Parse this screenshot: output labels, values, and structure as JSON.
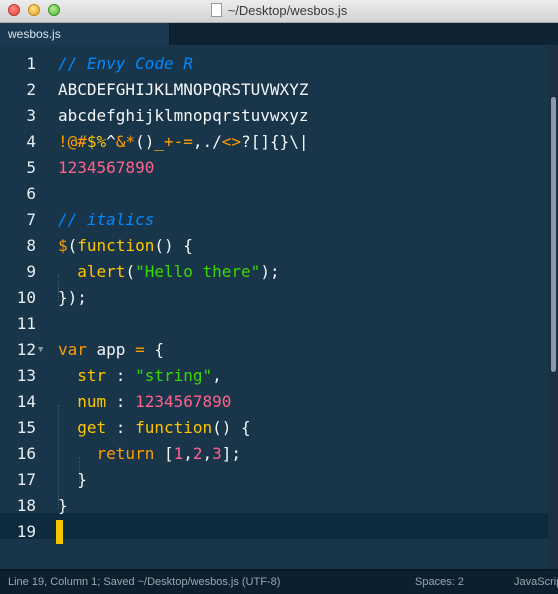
{
  "window": {
    "title": "~/Desktop/wesbos.js"
  },
  "tabs": [
    {
      "label": "wesbos.js"
    }
  ],
  "editor": {
    "line_numbers": [
      "1",
      "2",
      "3",
      "4",
      "5",
      "6",
      "7",
      "8",
      "9",
      "10",
      "11",
      "12",
      "13",
      "14",
      "15",
      "16",
      "17",
      "18",
      "19"
    ],
    "lines": {
      "l1": "// Envy Code R",
      "l2": "ABCDEFGHIJKLMNOPQRSTUVWXYZ",
      "l3": "abcdefghijklmnopqrstuvwxyz",
      "l4": {
        "a": "!@#",
        "b": "$%",
        "c": "^",
        "d": "&*",
        "e": "()",
        "f": "_",
        "g": "+-=",
        "h": ",./",
        "i": "<>",
        "j": "?[]{}\\|"
      },
      "l5": "1234567890",
      "l7": "// italics",
      "l8": {
        "a": "$",
        "b": "(",
        "c": "function",
        "d": "() {"
      },
      "l9": {
        "a": "alert",
        "b": "(",
        "c": "\"Hello there\"",
        "d": ");"
      },
      "l10": "});",
      "l12": {
        "a": "var",
        "b": " app ",
        "c": "=",
        "d": " {"
      },
      "l13": {
        "a": "str",
        "b": " : ",
        "c": "\"string\"",
        "d": ","
      },
      "l14": {
        "a": "num",
        "b": " : ",
        "c": "1234567890"
      },
      "l15": {
        "a": "get",
        "b": " : ",
        "c": "function",
        "d": "() {"
      },
      "l16": {
        "a": "return",
        "b": " [",
        "c": "1",
        "d": ",",
        "e": "2",
        "f": ",",
        "g": "3",
        "h": "];"
      },
      "l17": "}",
      "l18": "}"
    }
  },
  "status_bar": {
    "left": "Line 19, Column 1; Saved ~/Desktop/wesbos.js (UTF-8)",
    "spaces": "Spaces: 2",
    "syntax": "JavaScript"
  },
  "colors": {
    "background": "#193549",
    "comment": "#0088ff",
    "keyword": "#ff9d00",
    "function": "#ffc600",
    "string": "#3ad900",
    "number": "#ff628c",
    "caret": "#f7c500"
  }
}
